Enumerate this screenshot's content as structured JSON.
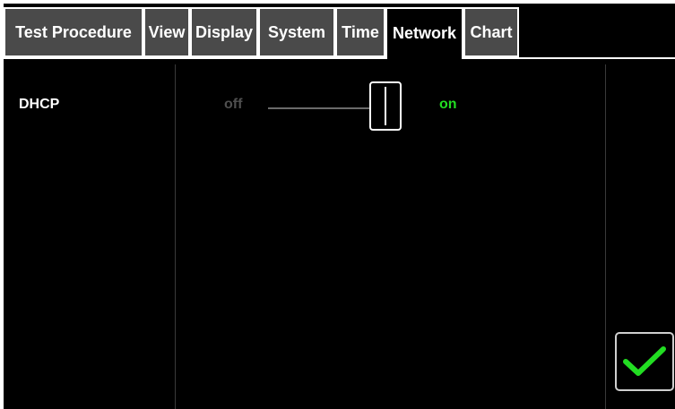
{
  "tabs": [
    {
      "label": "Test Procedure",
      "active": false
    },
    {
      "label": "View",
      "active": false
    },
    {
      "label": "Display",
      "active": false
    },
    {
      "label": "System",
      "active": false
    },
    {
      "label": "Time",
      "active": false
    },
    {
      "label": "Network",
      "active": true
    },
    {
      "label": "Chart",
      "active": false
    }
  ],
  "network": {
    "dhcp_label": "DHCP",
    "toggle_off_label": "off",
    "toggle_on_label": "on",
    "dhcp_enabled": true
  },
  "confirm": {
    "icon": "checkmark-icon"
  },
  "colors": {
    "background": "#000000",
    "tab_inactive": "#4a4a4a",
    "on_label": "#22dd22",
    "off_label": "#4f4f4f",
    "confirm_check": "#22dd22"
  }
}
